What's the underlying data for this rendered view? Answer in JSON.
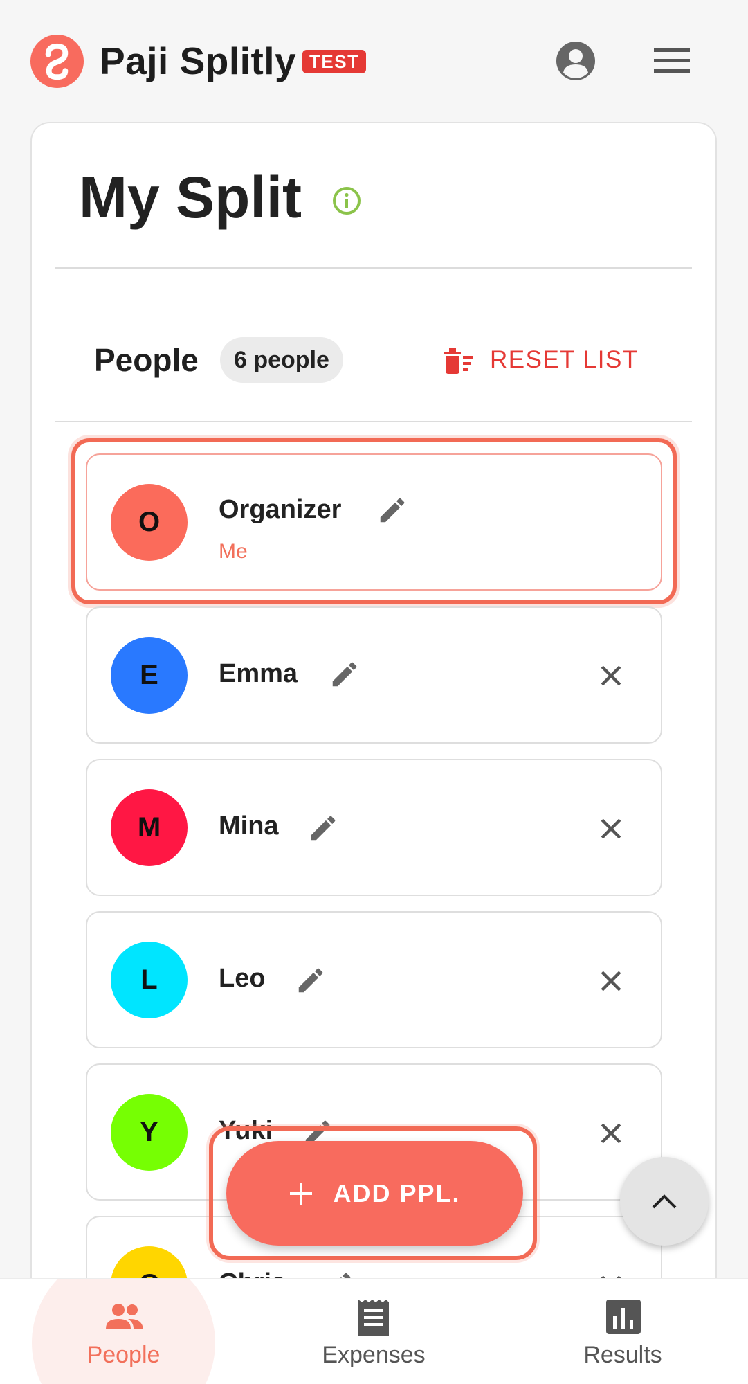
{
  "header": {
    "app_name": "Paji Splitly",
    "badge": "TEST",
    "account_icon": "account-circle-icon",
    "menu_icon": "hamburger-menu-icon"
  },
  "split": {
    "title": "My Split",
    "info_icon": "info-icon"
  },
  "people_section": {
    "label": "People",
    "count": "6 people",
    "reset_label": "RESET LIST"
  },
  "people": [
    {
      "initial": "O",
      "name": "Organizer",
      "subtitle": "Me",
      "color": "#fb6b5b"
    },
    {
      "initial": "E",
      "name": "Emma",
      "color": "#2979ff"
    },
    {
      "initial": "M",
      "name": "Mina",
      "color": "#ff1744"
    },
    {
      "initial": "L",
      "name": "Leo",
      "color": "#00e5ff"
    },
    {
      "initial": "Y",
      "name": "Yuki",
      "color": "#76ff03"
    },
    {
      "initial": "C",
      "name": "Chris",
      "color": "#ffd600"
    }
  ],
  "fab": {
    "add_label": "ADD PPL."
  },
  "bottom_nav": {
    "people": "People",
    "expenses": "Expenses",
    "results": "Results"
  },
  "colors": {
    "accent": "#f86b5e",
    "danger": "#e53935",
    "info": "#8bc34a"
  }
}
